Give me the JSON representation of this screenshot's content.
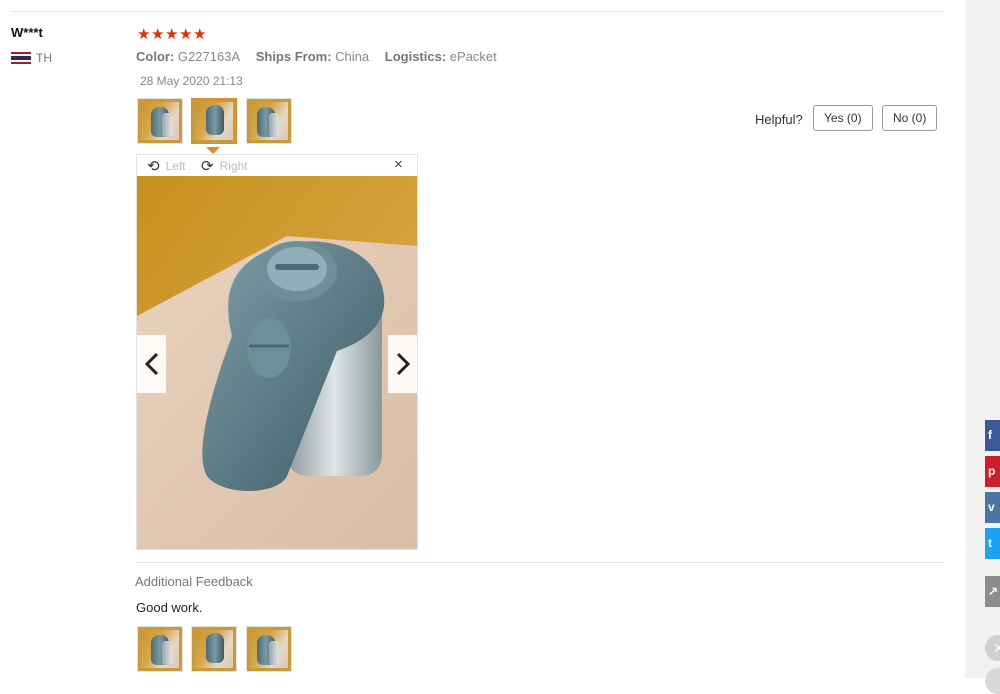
{
  "review": {
    "user": "W***t",
    "country": "TH",
    "stars": [
      "★",
      "★",
      "★",
      "★",
      "★"
    ],
    "rating": 5,
    "attributes": [
      {
        "label": "Color:",
        "value": "G227163A"
      },
      {
        "label": "Ships From:",
        "value": "China"
      },
      {
        "label": "Logistics:",
        "value": "ePacket"
      }
    ],
    "date": "28 May 2020 21:13"
  },
  "helpful": {
    "label": "Helpful?",
    "yes": "Yes (0)",
    "no": "No (0)"
  },
  "viewer": {
    "rotate_left": "Left",
    "rotate_right": "Right",
    "close": "×",
    "prev_icon": "chevron-left-icon",
    "next_icon": "chevron-right-icon"
  },
  "feedback": {
    "title": "Additional Feedback",
    "text": "Good work."
  },
  "share_icons": [
    "facebook-icon",
    "pinterest-icon",
    "vk-icon",
    "twitter-icon",
    "share-icon",
    "close-icon"
  ],
  "colors": {
    "star": "#e62e04",
    "selected_thumb": "#e38a2a",
    "facebook": "#3b5998",
    "pinterest": "#cb2027",
    "vk": "#4c75a3",
    "twitter": "#1da1f2"
  }
}
